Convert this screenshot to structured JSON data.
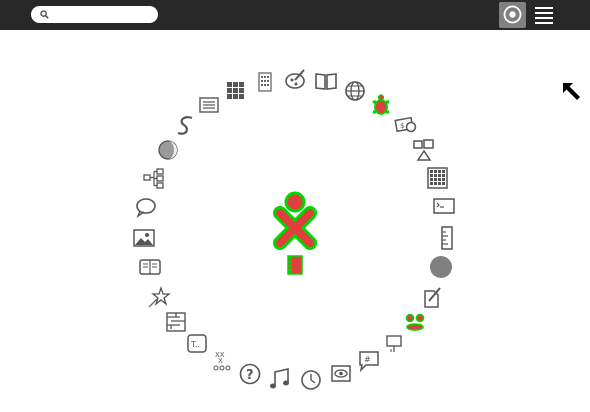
{
  "search": {
    "placeholder": "",
    "value": ""
  },
  "colors": {
    "topbar": "#282828",
    "xo_stroke": "#00d600",
    "xo_fill": "#e0403c",
    "icon_gray": "#555555",
    "selected_view_bg": "#808080"
  },
  "toolbar": {
    "views": [
      "home-ring-view-icon",
      "list-view-icon"
    ],
    "selected_view": "home-ring-view-icon"
  },
  "activities": [
    "calculate-icon",
    "paint-icon",
    "read-icon",
    "browse-icon",
    "turtleart-icon",
    "finance-icon",
    "physics-icon",
    "sudoku-grid-icon",
    "terminal-icon",
    "measure-ruler-icon",
    "gray-circle-icon",
    "write-icon",
    "speak-icon",
    "presentation-icon",
    "chat-memo-icon",
    "view-eye-icon",
    "clock-icon",
    "music-icon",
    "help-icon",
    "tictactoe-icon",
    "typing-turtle-icon",
    "maze-icon",
    "star-chart-icon",
    "ebook-reader-icon",
    "image-viewer-icon",
    "chat-bubble-icon",
    "mind-map-icon",
    "moon-icon",
    "snake-icon",
    "list-icon",
    "memorize-grid-icon"
  ],
  "center": {
    "owner_icon": "xo-owner-icon",
    "journal_icon": "journal-icon"
  }
}
